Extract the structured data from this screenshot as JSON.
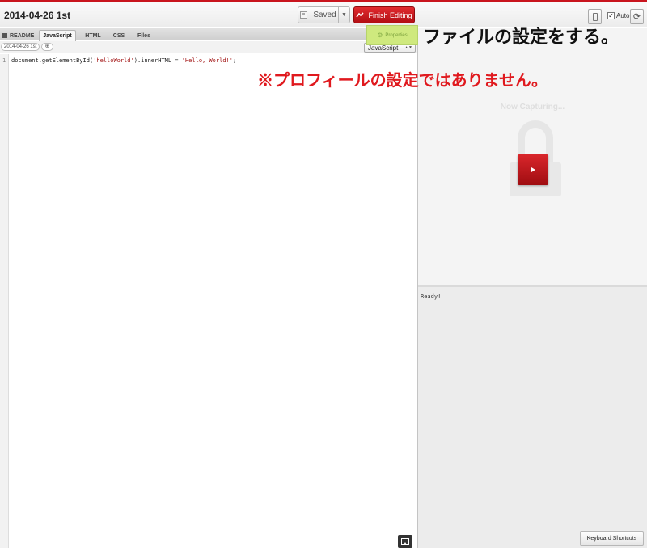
{
  "colors": {
    "accent_red": "#c9151e",
    "annotation_red": "#e0191e",
    "properties_green": "#cfe97e"
  },
  "header": {
    "title": "2014-04-26 1st",
    "saved_label": "Saved",
    "dropdown_glyph": "▼",
    "finish_label": "Finish Editing",
    "auto_label": "Auto",
    "auto_checked_glyph": "✓",
    "reload_glyph": "⟳"
  },
  "tabs": {
    "readme": "README",
    "javascript": "JavaScript",
    "html": "HTML",
    "css": "CSS",
    "files": "Files"
  },
  "subbar": {
    "breadcrumb": "2014-04-26 1st",
    "add_glyph": "⊕",
    "language": "JavaScript",
    "language_arrow": "▲▼"
  },
  "editor": {
    "line_number": "1",
    "code_prefix": "document.getElementById(",
    "code_string1": "'helloWorld'",
    "code_middle": ").innerHTML = ",
    "code_string2": "'Hello, World!'",
    "code_suffix": ";"
  },
  "properties": {
    "label": "Properties",
    "icon_glyph": "⚙"
  },
  "preview": {
    "status": "Now Capturing..."
  },
  "console": {
    "text": "Ready!",
    "shortcuts_label": "Keyboard Shortcuts"
  },
  "annotations": {
    "black": "ファイルの設定をする。",
    "red": "※プロフィールの設定ではありません。"
  }
}
